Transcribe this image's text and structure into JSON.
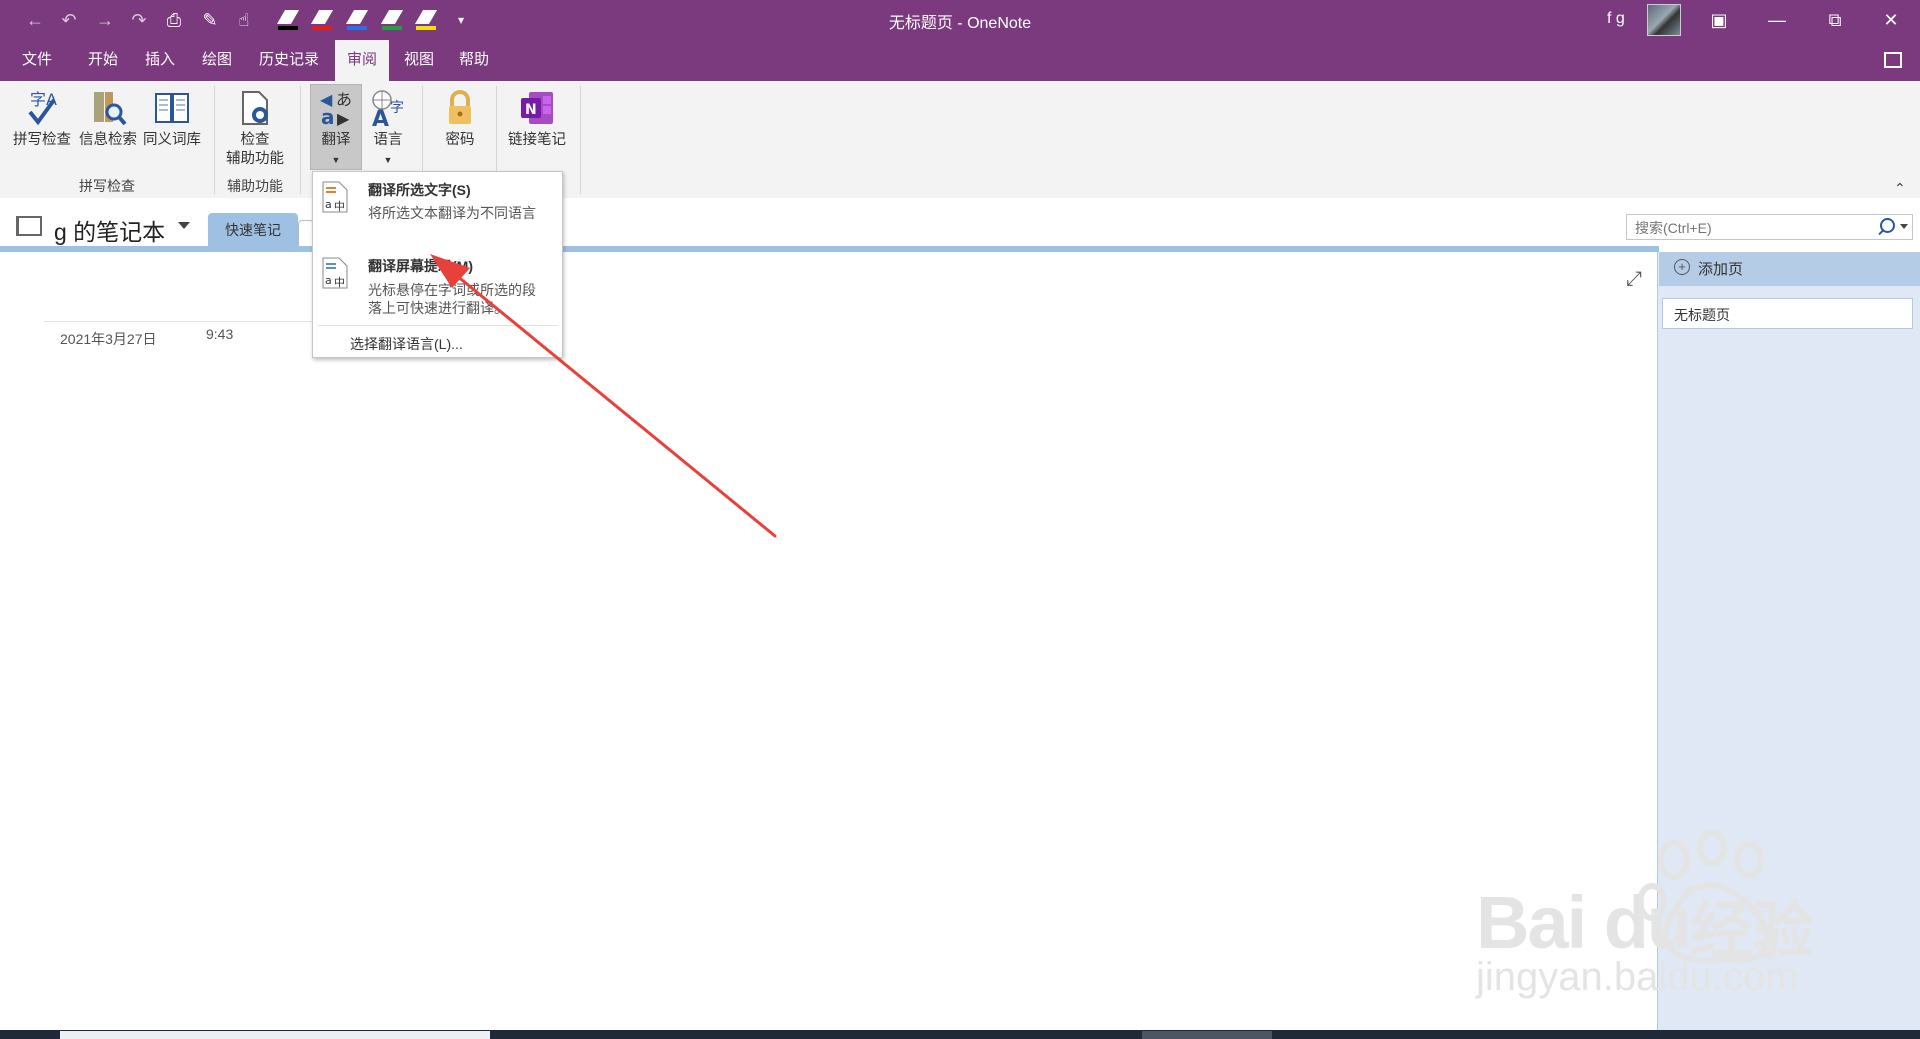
{
  "window": {
    "title": "无标题页 - OneNote",
    "user_name": "f g",
    "controls": [
      "restore",
      "minimize",
      "maximize",
      "close"
    ]
  },
  "quick_access": {
    "icons": [
      "back-icon",
      "undo-icon",
      "forward-icon",
      "redo-icon",
      "print-icon",
      "print-preview-icon",
      "touch-mode-icon",
      "pen-black-icon",
      "pen-red-icon",
      "pen-blue-icon",
      "pen-green-icon",
      "highlighter-yellow-icon",
      "customize-icon"
    ]
  },
  "ribbon_tabs": [
    "文件",
    "开始",
    "插入",
    "绘图",
    "历史记录",
    "审阅",
    "视图",
    "帮助"
  ],
  "ribbon": {
    "spell_group": {
      "label": "拼写检查",
      "buttons": [
        "拼写检查",
        "信息检索",
        "同义词库"
      ]
    },
    "accessibility_group": {
      "label": "辅助功能",
      "button_line1": "检查",
      "button_line2": "辅助功能"
    },
    "translate_label": "翻译",
    "language_label": "语言",
    "password_label": "密码",
    "linked_notes_label": "链接笔记"
  },
  "notebook": {
    "title": "g 的笔记本",
    "section_tab": "快速笔记"
  },
  "search": {
    "placeholder": "搜索(Ctrl+E)"
  },
  "page_pane": {
    "add_page": "添加页",
    "pages": [
      "无标题页"
    ]
  },
  "note": {
    "date": "2021年3月27日",
    "time": "9:43"
  },
  "translate_menu": {
    "item1_title": "翻译所选文字(S)",
    "item1_desc": "将所选文本翻译为不同语言",
    "item2_title": "翻译屏幕提示(M)",
    "item2_desc": "光标悬停在字词或所选的段落上可快速进行翻译。",
    "language_option": "选择翻译语言(L)..."
  },
  "watermark": {
    "brand": "Bai du",
    "brand_cn": "经验",
    "url": "jingyan.baidu.com"
  },
  "colors": {
    "title_bar": "#7a3a7d",
    "ribbon_bg": "#f3f3f3",
    "section_tab": "#9ec0e3",
    "page_pane": "#dfe8f4",
    "annotation_arrow": "#e8403a"
  }
}
